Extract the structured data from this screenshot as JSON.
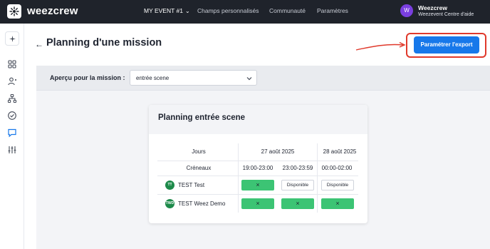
{
  "topbar": {
    "brand": "weezcrew",
    "nav": {
      "event": "MY EVENT #1",
      "custom_fields": "Champs personnalisés",
      "community": "Communauté",
      "settings": "Paramètres"
    },
    "user": {
      "initial": "W",
      "name": "Weezcrew",
      "org": "Weezevent Centre d'aide"
    }
  },
  "sidebar": {
    "icons": [
      "sparkle-icon",
      "dashboard-icon",
      "users-icon",
      "org-chart-icon",
      "check-circle-icon",
      "chat-icon",
      "sliders-icon"
    ],
    "active": "chat-icon"
  },
  "header": {
    "title": "Planning d'une mission",
    "export_button": "Paramétrer l'export"
  },
  "filter": {
    "label": "Aperçu pour la mission :",
    "selected": "entrée scene"
  },
  "planning": {
    "title": "Planning entrée scene",
    "days_label": "Jours",
    "slots_label": "Créneaux",
    "dates": [
      "27 août 2025",
      "28 août 2025"
    ],
    "slots": [
      "19:00-23:00",
      "23:00-23:59",
      "00:00-02:00"
    ],
    "people": [
      {
        "initials": "TT",
        "name": "TEST Test",
        "cells": [
          "×",
          "Disponible",
          "Disponible"
        ]
      },
      {
        "initials": "TWD",
        "name": "TEST Weez Demo",
        "cells": [
          "×",
          "×",
          "×"
        ]
      }
    ]
  },
  "colors": {
    "topbar_bg": "#1f232b",
    "accent_blue": "#1778ea",
    "assigned_green": "#3cc474",
    "badge_green": "#1d8a4a",
    "avatar_purple": "#7a3fe0",
    "highlight_red": "#e0392b"
  }
}
